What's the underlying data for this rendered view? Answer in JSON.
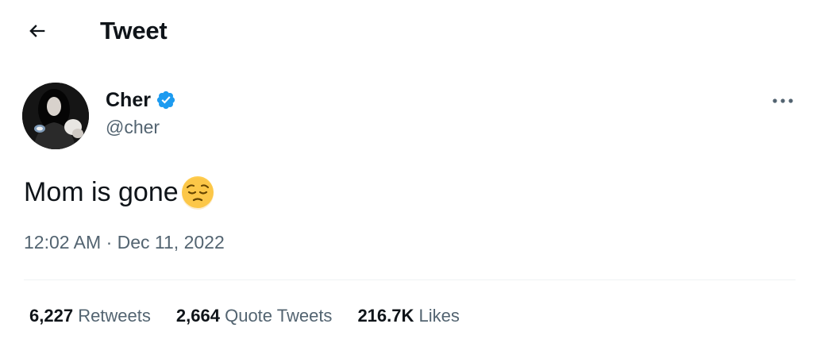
{
  "header": {
    "title": "Tweet",
    "back_icon": "arrow-left-icon"
  },
  "author": {
    "display_name": "Cher",
    "handle": "@cher",
    "verified": true,
    "verified_icon": "verified-badge-icon",
    "verified_color": "#1d9bf0"
  },
  "tweet": {
    "text": "Mom is gone",
    "emoji_icon": "pensive-face-icon",
    "time": "12:02 AM",
    "separator": "·",
    "date": "Dec 11, 2022"
  },
  "more_icon": "more-options-icon",
  "stats": [
    {
      "count": "6,227",
      "label": "Retweets"
    },
    {
      "count": "2,664",
      "label": "Quote Tweets"
    },
    {
      "count": "216.7K",
      "label": "Likes"
    }
  ],
  "colors": {
    "text_primary": "#0f1419",
    "text_secondary": "#536471",
    "divider": "#eff3f4",
    "background": "#ffffff"
  }
}
